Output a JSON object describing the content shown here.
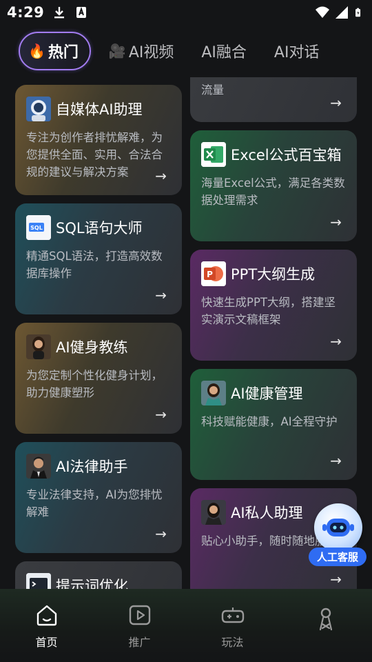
{
  "status_bar": {
    "time": "4:29"
  },
  "tabs": [
    {
      "emoji": "🔥",
      "label": "热门"
    },
    {
      "emoji": "🎥",
      "label": "AI视频"
    },
    {
      "emoji": "",
      "label": "AI融合"
    },
    {
      "emoji": "",
      "label": "AI对话"
    }
  ],
  "cards_left": [
    {
      "title": "自媒体AI助理",
      "desc": "专注为创作者排忧解难，为您提供全面、实用、合法合规的建议与解决方案",
      "icon": "astronaut-avatar-icon"
    },
    {
      "title": "SQL语句大师",
      "desc": "精通SQL语法，打造高效数据库操作",
      "icon": "sql-file-icon"
    },
    {
      "title": "AI健身教练",
      "desc": "为您定制个性化健身计划，助力健康塑形",
      "icon": "fitness-coach-avatar-icon"
    },
    {
      "title": "AI法律助手",
      "desc": "专业法律支持，AI为您排忧解难",
      "icon": "lawyer-avatar-icon"
    },
    {
      "title": "提示词优化",
      "desc": "",
      "icon": "terminal-icon"
    }
  ],
  "cards_right": [
    {
      "title": "",
      "desc": "流量",
      "icon": ""
    },
    {
      "title": "Excel公式百宝箱",
      "desc": "海量Excel公式，满足各类数据处理需求",
      "icon": "excel-icon"
    },
    {
      "title": "PPT大纲生成",
      "desc": "快速生成PPT大纲，搭建坚实演示文稿框架",
      "icon": "powerpoint-icon"
    },
    {
      "title": "AI健康管理",
      "desc": "科技赋能健康，AI全程守护",
      "icon": "doctor-avatar-icon"
    },
    {
      "title": "AI私人助理",
      "desc": "贴心小助手，随时随地服务",
      "icon": "assistant-avatar-icon"
    }
  ],
  "arrow_glyph": "→",
  "customer_service": {
    "label": "人工客服"
  },
  "bottom_nav": [
    {
      "label": "首页",
      "icon": "home-icon",
      "active": true
    },
    {
      "label": "推广",
      "icon": "play-icon",
      "active": false
    },
    {
      "label": "玩法",
      "icon": "gamepad-icon",
      "active": false
    },
    {
      "label": "",
      "icon": "user-icon",
      "active": false
    }
  ],
  "colors": {
    "background": "#141517",
    "active_tab_border": "#a37cf0",
    "customer_service_badge": "#2f6cf2",
    "excel_green": "#1f8a4c",
    "ppt_red": "#d24726"
  }
}
